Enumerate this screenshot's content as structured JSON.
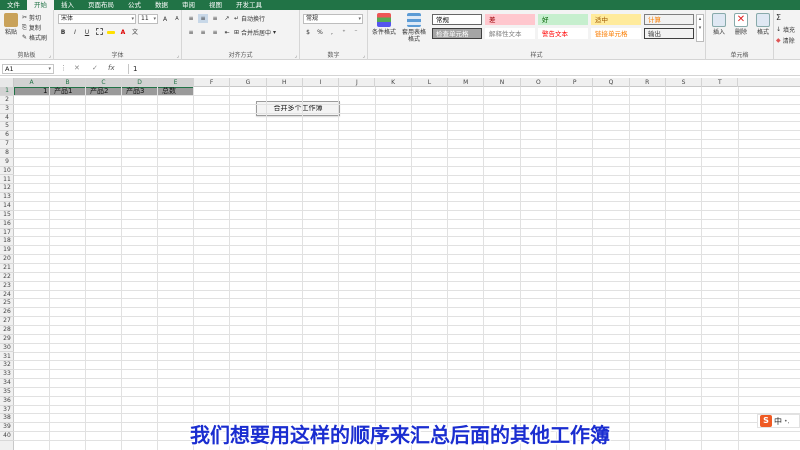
{
  "tabs": [
    "文件",
    "开始",
    "插入",
    "页面布局",
    "公式",
    "数据",
    "审阅",
    "视图",
    "开发工具"
  ],
  "active_tab_index": 1,
  "clipboard": {
    "paste": "粘贴",
    "cut": "剪切",
    "copy": "复制",
    "format_painter": "格式刷",
    "label": "剪贴板"
  },
  "font": {
    "name": "宋体",
    "size": "11",
    "grow": "A",
    "shrink": "A",
    "bold": "B",
    "italic": "I",
    "underline": "U",
    "wen": "文",
    "label": "字体"
  },
  "alignment": {
    "wrap_text": "自动换行",
    "merge_center": "合并后居中",
    "label": "对齐方式"
  },
  "number": {
    "format": "常规",
    "percent": "%",
    "comma": ",",
    "label": "数字"
  },
  "styles": {
    "cond_format": "条件格式",
    "table_format": "套用表格格式",
    "cells": [
      {
        "text": "常规",
        "bg": "#ffffff",
        "color": "#000000",
        "border": "#666666"
      },
      {
        "text": "差",
        "bg": "#ffc7ce",
        "color": "#9c0006",
        "border": "#ffc7ce"
      },
      {
        "text": "好",
        "bg": "#c6efce",
        "color": "#006100",
        "border": "#c6efce"
      },
      {
        "text": "适中",
        "bg": "#ffeb9c",
        "color": "#9c5700",
        "border": "#ffeb9c"
      },
      {
        "text": "计算",
        "bg": "#f2f2f2",
        "color": "#fa7d00",
        "border": "#7f7f7f"
      },
      {
        "text": "检查单元格",
        "bg": "#a5a5a5",
        "color": "#ffffff",
        "border": "#3f3f3f"
      },
      {
        "text": "解释性文本",
        "bg": "#ffffff",
        "color": "#7f7f7f",
        "border": "#ffffff"
      },
      {
        "text": "警告文本",
        "bg": "#ffffff",
        "color": "#ff0000",
        "border": "#ffffff"
      },
      {
        "text": "链接单元格",
        "bg": "#ffffff",
        "color": "#fa7d00",
        "border": "#ffffff"
      },
      {
        "text": "输出",
        "bg": "#f2f2f2",
        "color": "#3f3f3f",
        "border": "#3f3f3f"
      }
    ],
    "label": "样式"
  },
  "cells_group": {
    "insert": "插入",
    "delete": "删除",
    "format": "格式",
    "label": "单元格"
  },
  "editing": {
    "fill": "填充",
    "clear": "清除",
    "sigma": "Σ"
  },
  "formula_bar": {
    "name_box": "A1",
    "cancel": "✕",
    "enter": "✓",
    "fx": "fx",
    "content": "1"
  },
  "columns": [
    "A",
    "B",
    "C",
    "D",
    "E",
    "F",
    "G",
    "H",
    "I",
    "J",
    "K",
    "L",
    "M",
    "N",
    "O",
    "P",
    "Q",
    "R",
    "S",
    "T"
  ],
  "selected_columns": [
    "A",
    "B",
    "C",
    "D",
    "E"
  ],
  "rows": [
    "1",
    "2",
    "3",
    "4",
    "5",
    "6",
    "7",
    "8",
    "9",
    "10",
    "11",
    "12",
    "13",
    "14",
    "15",
    "16",
    "17",
    "18",
    "19",
    "20",
    "21",
    "22",
    "23",
    "24",
    "25",
    "26",
    "27",
    "28",
    "29",
    "30",
    "31",
    "32",
    "33",
    "34",
    "35",
    "36",
    "37",
    "38",
    "39",
    "40"
  ],
  "row1_cells": [
    {
      "col": "A",
      "text": "1"
    },
    {
      "col": "B",
      "text": "产品1"
    },
    {
      "col": "C",
      "text": "产品2"
    },
    {
      "col": "D",
      "text": "产品3"
    },
    {
      "col": "E",
      "text": "总数"
    }
  ],
  "merge_button": "合并多个工作簿",
  "subtitle": "我们想要用这样的顺序来汇总后面的其他工作簿",
  "ime": {
    "logo": "S",
    "text": "中",
    "dots": "•,"
  },
  "colors": {
    "accent": "#217346",
    "subtitle": "#1a2dd0"
  }
}
